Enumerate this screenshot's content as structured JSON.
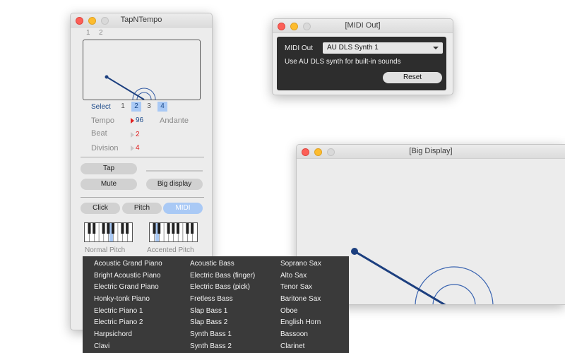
{
  "tap_window": {
    "title": "TapNTempo",
    "tabs": [
      "1",
      "2"
    ],
    "select_label": "Select",
    "select_options": [
      "1",
      "2",
      "3",
      "4"
    ],
    "tempo_label": "Tempo",
    "tempo_value": "96",
    "tempo_name": "Andante",
    "beat_label": "Beat",
    "beat_value": "2",
    "division_label": "Division",
    "division_value": "4",
    "tap_label": "Tap",
    "mute_label": "Mute",
    "big_display_label": "Big display",
    "click_label": "Click",
    "pitch_label": "Pitch",
    "midi_label": "MIDI",
    "normal_pitch_label": "Normal Pitch",
    "accented_pitch_label": "Accented Pitch"
  },
  "midi_window": {
    "title": "[MIDI Out]",
    "label": "MIDI Out",
    "selected": "AU DLS Synth 1",
    "hint": "Use AU DLS synth for built-in sounds",
    "reset_label": "Reset"
  },
  "big_window": {
    "title": "[Big Display]"
  },
  "instrument_menu": {
    "columns": [
      [
        "Acoustic Grand Piano",
        "Bright Acoustic Piano",
        "Electric Grand Piano",
        "Honky-tonk Piano",
        "Electric Piano 1",
        "Electric Piano 2",
        "Harpsichord",
        "Clavi"
      ],
      [
        "Acoustic Bass",
        "Electric Bass (finger)",
        "Electric Bass (pick)",
        "Fretless Bass",
        "Slap Bass 1",
        "Slap Bass 2",
        "Synth Bass 1",
        "Synth Bass 2"
      ],
      [
        "Soprano Sax",
        "Alto Sax",
        "Tenor Sax",
        "Baritone Sax",
        "Oboe",
        "English Horn",
        "Bassoon",
        "Clarinet"
      ]
    ]
  },
  "colors": {
    "accent": "#a9c9f5",
    "value_red": "#e02020",
    "tempo_blue": "#1c4a8a",
    "pendulum_blue": "#1c3f7f"
  }
}
